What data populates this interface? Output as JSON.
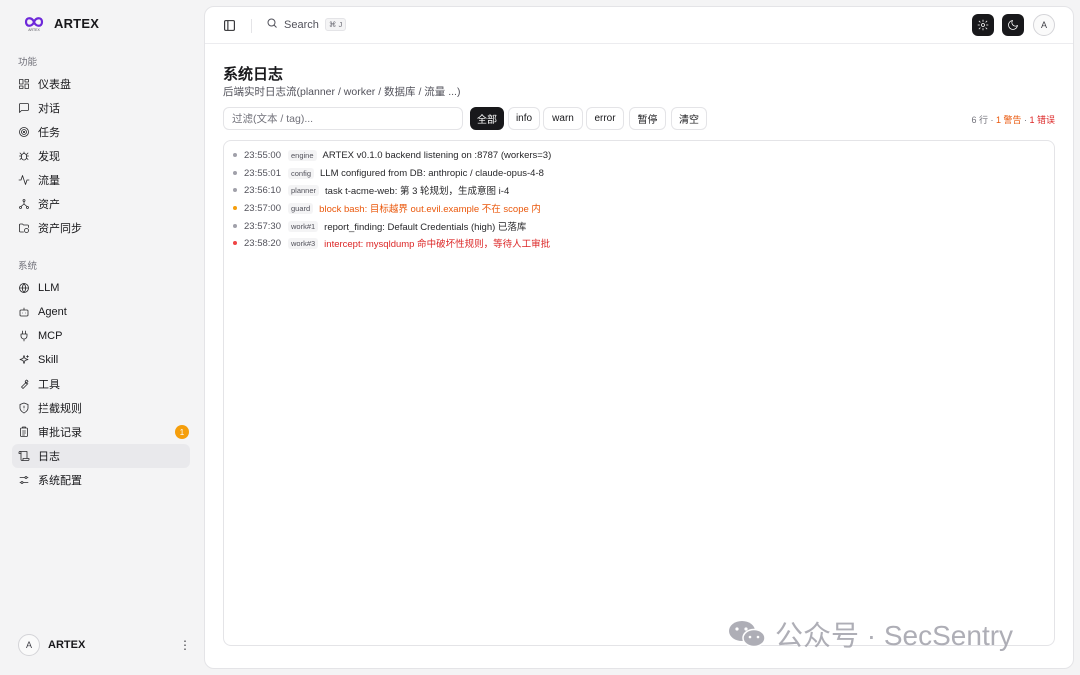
{
  "brand": {
    "name": "ARTEX",
    "sub": "ARTEX"
  },
  "sidebar": {
    "sections": [
      {
        "label": "功能",
        "items": [
          {
            "label": "仪表盘",
            "icon": "dashboard-icon"
          },
          {
            "label": "对话",
            "icon": "chat-icon"
          },
          {
            "label": "任务",
            "icon": "target-icon"
          },
          {
            "label": "发现",
            "icon": "bug-icon"
          },
          {
            "label": "流量",
            "icon": "activity-icon"
          },
          {
            "label": "资产",
            "icon": "network-icon"
          },
          {
            "label": "资产同步",
            "icon": "folder-sync-icon"
          }
        ]
      },
      {
        "label": "系统",
        "items": [
          {
            "label": "LLM",
            "icon": "globe-icon"
          },
          {
            "label": "Agent",
            "icon": "bot-icon"
          },
          {
            "label": "MCP",
            "icon": "plug-icon"
          },
          {
            "label": "Skill",
            "icon": "sparkles-icon"
          },
          {
            "label": "工具",
            "icon": "wrench-icon"
          },
          {
            "label": "拦截规则",
            "icon": "shield-icon"
          },
          {
            "label": "审批记录",
            "icon": "clipboard-icon",
            "badge": "1"
          },
          {
            "label": "日志",
            "icon": "scroll-icon",
            "active": true
          },
          {
            "label": "系统配置",
            "icon": "sliders-icon"
          }
        ]
      }
    ],
    "user": {
      "avatar": "A",
      "name": "ARTEX"
    }
  },
  "topbar": {
    "search_label": "Search",
    "shortcut": "⌘ J",
    "avatar": "A"
  },
  "page": {
    "title": "系统日志",
    "subtitle": "后端实时日志流(planner / worker / 数据库 / 流量 ...)",
    "filter_placeholder": "过滤(文本 / tag)...",
    "levels": {
      "all": "全部",
      "info": "info",
      "warn": "warn",
      "error": "error"
    },
    "pause_label": "暂停",
    "clear_label": "清空",
    "counts": {
      "lines": "6 行 · ",
      "warnings": "1 警告",
      "sep": " · ",
      "errors": "1 错误"
    }
  },
  "logs": [
    {
      "time": "23:55:00",
      "tag": "engine",
      "level": "info",
      "message": "ARTEX v0.1.0 backend listening on :8787 (workers=3)"
    },
    {
      "time": "23:55:01",
      "tag": "config",
      "level": "info",
      "message": "LLM configured from DB: anthropic / claude-opus-4-8"
    },
    {
      "time": "23:56:10",
      "tag": "planner",
      "level": "info",
      "message": "task t-acme-web: 第 3 轮规划，生成意图 i-4"
    },
    {
      "time": "23:57:00",
      "tag": "guard",
      "level": "warn",
      "message": "block bash: 目标越界 out.evil.example 不在 scope 内"
    },
    {
      "time": "23:57:30",
      "tag": "work#1",
      "level": "info",
      "message": "report_finding: Default Credentials (high) 已落库"
    },
    {
      "time": "23:58:20",
      "tag": "work#3",
      "level": "error",
      "message": "intercept: mysqldump 命中破坏性规则，等待人工审批"
    }
  ],
  "watermark": "公众号 · SecSentry",
  "colors": {
    "accent": "#18181b",
    "warn": "#ea580c",
    "error": "#dc2626",
    "badge": "#f59e0b"
  }
}
